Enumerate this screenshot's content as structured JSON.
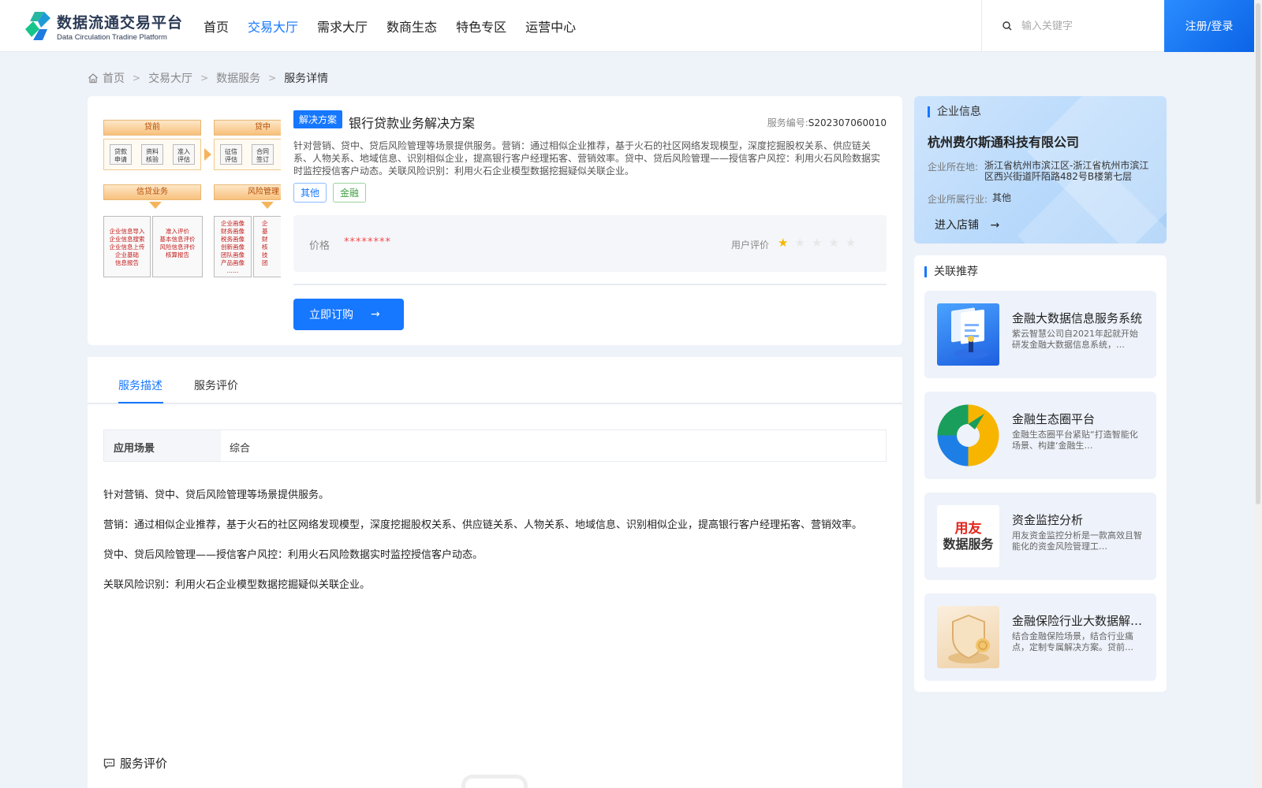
{
  "brand": {
    "name_cn": "数据流通交易平台",
    "name_en": "Data Circulation Tradine Platform"
  },
  "nav": [
    "首页",
    "交易大厅",
    "需求大厅",
    "数商生态",
    "特色专区",
    "运营中心"
  ],
  "search": {
    "placeholder": "输入关键字"
  },
  "login_label": "注册/登录",
  "breadcrumb": [
    "首页",
    "交易大厅",
    "数据服务",
    "服务详情"
  ],
  "product": {
    "type_tag": "解决方案",
    "title": "银行贷款业务解决方案",
    "service_no_label": "服务编号:",
    "service_no": "S202307060010",
    "description": "针对营销、贷中、贷后风险管理等场景提供服务。营销：通过相似企业推荐，基于火石的社区网络发现模型，深度挖掘股权关系、供应链关系、人物关系、地域信息、识别相似企业，提高银行客户经理拓客、营销效率。贷中、贷后风险管理——授信客户风控：利用火石风险数据实时监控授信客户动态。关联风险识别：利用火石企业模型数据挖掘疑似关联企业。",
    "tags": [
      "其他",
      "金融"
    ],
    "price_label": "价格",
    "price_value": "********",
    "rating_label": "用户评价",
    "rating": 1,
    "rating_max": 5,
    "buy_label": "立即订购",
    "thumbnail": {
      "stage1": "贷前",
      "stage2": "贷中",
      "boxes1": [
        "贷款\n申请",
        "资料\n核验",
        "准入\n评估"
      ],
      "boxes2": [
        "征信\n评估",
        "合同\n签订"
      ],
      "sec1": "信贷业务",
      "sec2": "风险管理",
      "panel1": "企业信息导入\n企业信息搜索\n企业信息上传\n企业基础\n信息报告",
      "panel2": "准入评价\n基本信息评价\n风险信息评价\n核算报告",
      "panel3": "企业画像\n财务画像\n税务画像\n创新画像\n团队画像\n产品画像\n……",
      "panel4": "企\n基\n财\n核\n技\n团"
    }
  },
  "tabs": [
    "服务描述",
    "服务评价"
  ],
  "scene": {
    "key": "应用场景",
    "value": "综合"
  },
  "detail_paragraphs": [
    "针对营销、贷中、贷后风险管理等场景提供服务。",
    "营销：通过相似企业推荐，基于火石的社区网络发现模型，深度挖掘股权关系、供应链关系、人物关系、地域信息、识别相似企业，提高银行客户经理拓客、营销效率。",
    "贷中、贷后风险管理——授信客户风控：利用火石风险数据实时监控授信客户动态。",
    "关联风险识别：利用火石企业模型数据挖掘疑似关联企业。"
  ],
  "evaluation_title": "服务评价",
  "company": {
    "section_title": "企业信息",
    "name": "杭州费尔斯通科技有限公司",
    "location_label": "企业所在地:",
    "location": "浙江省杭州市滨江区-浙江省杭州市滨江区西兴街道阡陌路482号B楼第七层",
    "industry_label": "企业所属行业:",
    "industry": "其他",
    "enter_shop": "进入店铺"
  },
  "recommend": {
    "section_title": "关联推荐",
    "items": [
      {
        "title": "金融大数据信息服务系统",
        "desc": "紫云智慧公司自2021年起就开始研发金融大数据信息系统，…"
      },
      {
        "title": "金融生态圈平台",
        "desc": "金融生态圈平台紧贴“打造智能化场景、构建‘金融生…"
      },
      {
        "title": "资金监控分析",
        "desc": "用友资金监控分析是一款高效且智能化的资金风险管理工…",
        "logo_line1": "用友",
        "logo_line2": "数据服务"
      },
      {
        "title": "金融保险行业大数据解决方案",
        "desc": "结合金融保险场景，结合行业痛点，定制专属解决方案。贷前…"
      }
    ]
  },
  "colors": {
    "primary": "#1677ff",
    "price": "#f04b4b",
    "star": "#f6b800",
    "tag_green": "#43a047"
  }
}
